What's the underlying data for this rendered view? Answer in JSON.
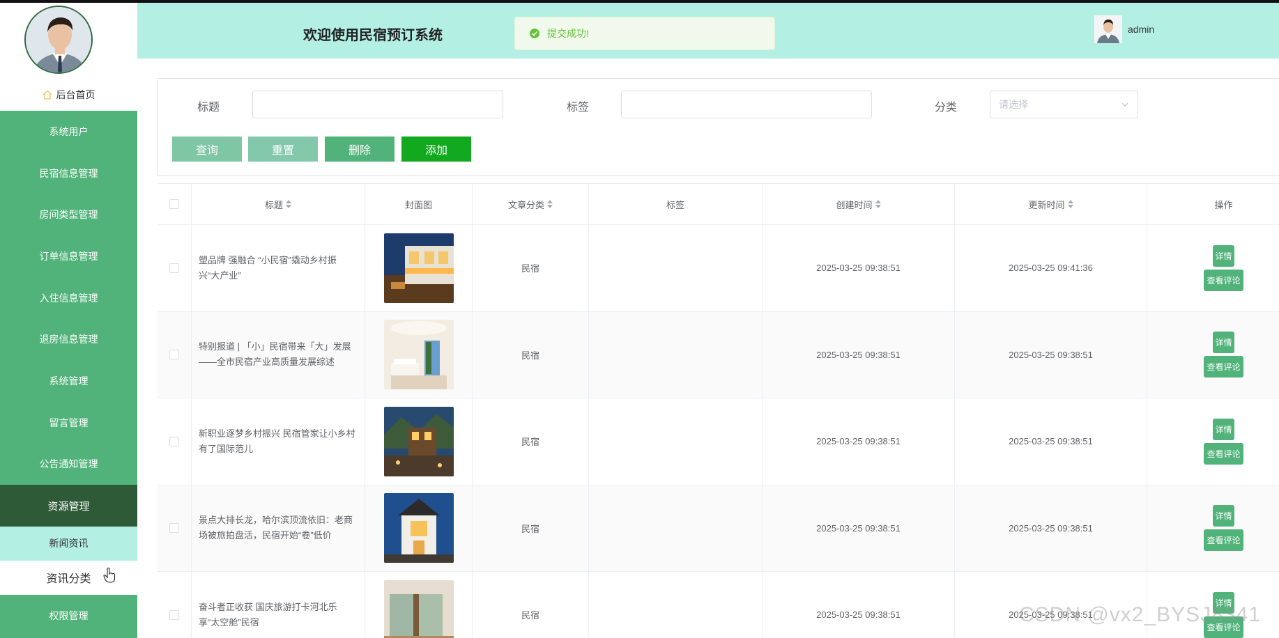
{
  "header": {
    "site_title": "欢迎使用民宿预订系统",
    "toast": "提交成功!",
    "user_name": "admin"
  },
  "sidebar": {
    "home_label": "后台首页",
    "menu": [
      "系统用户",
      "民宿信息管理",
      "房间类型管理",
      "订单信息管理",
      "入住信息管理",
      "退房信息管理",
      "系统管理",
      "留言管理",
      "公告通知管理"
    ],
    "active_menu": "资源管理",
    "submenu": [
      "新闻资讯",
      "资讯分类"
    ],
    "last_menu": "权限管理"
  },
  "search": {
    "title_label": "标题",
    "tag_label": "标签",
    "category_label": "分类",
    "category_placeholder": "请选择",
    "btn_query": "查询",
    "btn_reset": "重置",
    "btn_delete": "删除",
    "btn_add": "添加"
  },
  "table": {
    "headers": {
      "title": "标题",
      "cover": "封面图",
      "category": "文章分类",
      "tag": "标签",
      "created": "创建时间",
      "updated": "更新时间",
      "op": "操作"
    },
    "rows": [
      {
        "title": "塑品牌 强融合 “小民宿”撬动乡村振兴“大产业”",
        "category": "民宿",
        "tag": "",
        "created": "2025-03-25 09:38:51",
        "updated": "2025-03-25 09:41:36"
      },
      {
        "title": "特别报道 | 「小」民宿带来「大」发展——全市民宿产业高质量发展综述",
        "category": "民宿",
        "tag": "",
        "created": "2025-03-25 09:38:51",
        "updated": "2025-03-25 09:38:51"
      },
      {
        "title": "新职业逐梦乡村振兴 民宿管家让小乡村有了国际范儿",
        "category": "民宿",
        "tag": "",
        "created": "2025-03-25 09:38:51",
        "updated": "2025-03-25 09:38:51"
      },
      {
        "title": "景点大排长龙，哈尔滨顶流依旧：老商场被旅拍盘活，民宿开始“卷”低价",
        "category": "民宿",
        "tag": "",
        "created": "2025-03-25 09:38:51",
        "updated": "2025-03-25 09:38:51"
      },
      {
        "title": "奋斗者正收获 国庆旅游打卡河北乐享“太空舱”民宿",
        "category": "民宿",
        "tag": "",
        "created": "2025-03-25 09:38:51",
        "updated": "2025-03-25 09:38:51"
      }
    ],
    "op_detail": "详情",
    "op_comments": "查看评论"
  },
  "watermark": "CSDN @vx2_BYSJ8341",
  "colors": {
    "header_bg": "#b3f0e3",
    "menu_bg": "#52b37a",
    "menu_active": "#2f5a38",
    "btn_query": "#7fc6a4",
    "btn_reset": "#84c8ac",
    "btn_delete": "#52b37a",
    "btn_add": "#13a91f"
  }
}
